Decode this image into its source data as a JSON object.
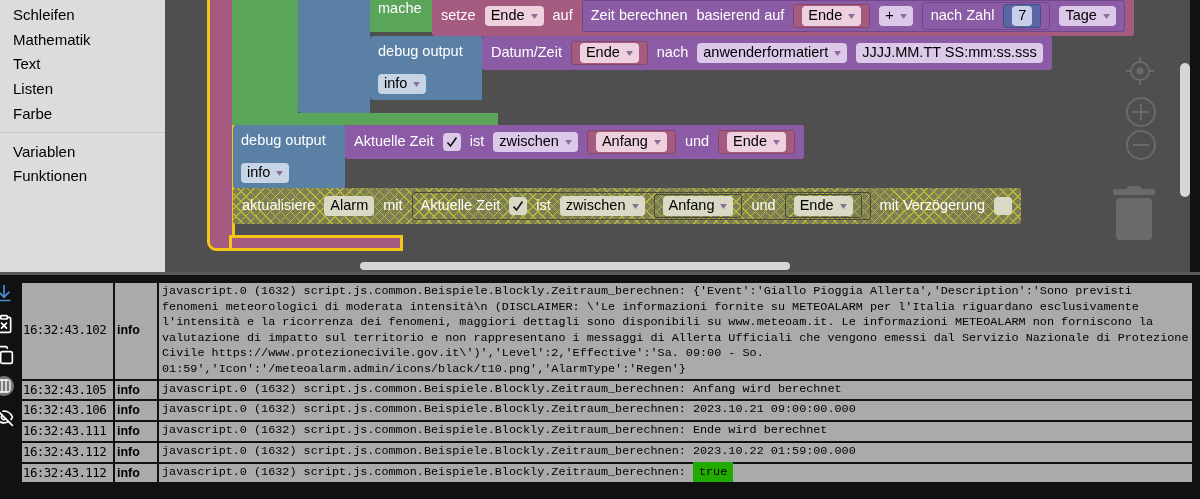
{
  "toolbox": {
    "groups": [
      {
        "items": [
          "Schleifen",
          "Mathematik",
          "Text",
          "Listen",
          "Farbe"
        ]
      },
      {
        "items": [
          "Variablen",
          "Funktionen"
        ]
      }
    ]
  },
  "workspace": {
    "event_block": {
      "selected": true
    },
    "loop_block": {
      "label": "mache"
    },
    "blocks": [
      {
        "kind": "variable",
        "parts": [
          {
            "kind": "label",
            "text": "setze"
          },
          {
            "kind": "dropdown",
            "text": "Ende"
          },
          {
            "kind": "label",
            "text": "auf"
          },
          {
            "kind": "block",
            "block": {
              "kind": "time",
              "parts": [
                {
                  "kind": "label",
                  "text": "Zeit berechnen"
                },
                {
                  "kind": "label",
                  "text": "basierend auf"
                },
                {
                  "kind": "block",
                  "block": {
                    "kind": "variable",
                    "parts": [
                      {
                        "kind": "dropdown",
                        "text": "Ende"
                      }
                    ]
                  }
                },
                {
                  "kind": "dropdown",
                  "text": "+"
                },
                {
                  "kind": "block",
                  "block": {
                    "kind": "time",
                    "parts": [
                      {
                        "kind": "label",
                        "text": "nach Zahl"
                      },
                      {
                        "kind": "block",
                        "block": {
                          "kind": "math",
                          "parts": [
                            {
                              "kind": "field",
                              "text": "7"
                            }
                          ]
                        }
                      }
                    ]
                  }
                },
                {
                  "kind": "dropdown",
                  "text": "Tage"
                }
              ]
            }
          }
        ]
      },
      {
        "kind": "debug",
        "parts": [
          {
            "kind": "label",
            "text": "debug output"
          },
          {
            "kind": "dropdown",
            "text": "info"
          }
        ],
        "input": {
          "kind": "time",
          "parts": [
            {
              "kind": "label",
              "text": "Datum/Zeit"
            },
            {
              "kind": "block",
              "block": {
                "kind": "variable",
                "parts": [
                  {
                    "kind": "dropdown",
                    "text": "Ende"
                  }
                ]
              }
            },
            {
              "kind": "label",
              "text": "nach"
            },
            {
              "kind": "dropdown",
              "text": "anwenderformatiert"
            },
            {
              "kind": "field",
              "text": "JJJJ.MM.TT SS:mm:ss.sss"
            }
          ]
        }
      },
      {
        "kind": "debug",
        "parts": [
          {
            "kind": "label",
            "text": "debug output"
          },
          {
            "kind": "dropdown",
            "text": "info"
          }
        ],
        "input": {
          "kind": "time",
          "parts": [
            {
              "kind": "label",
              "text": "Aktuelle Zeit"
            },
            {
              "kind": "check",
              "checked": true
            },
            {
              "kind": "label",
              "text": "ist"
            },
            {
              "kind": "dropdown",
              "text": "zwischen"
            },
            {
              "kind": "block",
              "block": {
                "kind": "variable",
                "parts": [
                  {
                    "kind": "dropdown",
                    "text": "Anfang"
                  }
                ]
              }
            },
            {
              "kind": "label",
              "text": "und"
            },
            {
              "kind": "block",
              "block": {
                "kind": "variable",
                "parts": [
                  {
                    "kind": "dropdown",
                    "text": "Ende"
                  }
                ]
              }
            }
          ]
        }
      },
      {
        "kind": "alarm",
        "disabled": true,
        "parts": [
          {
            "kind": "label",
            "text": "aktualisiere"
          },
          {
            "kind": "field",
            "text": "Alarm"
          },
          {
            "kind": "label",
            "text": "mit"
          },
          {
            "kind": "block",
            "block": {
              "kind": "time",
              "parts": [
                {
                  "kind": "label",
                  "text": "Aktuelle Zeit"
                },
                {
                  "kind": "check",
                  "checked": true
                },
                {
                  "kind": "label",
                  "text": "ist"
                },
                {
                  "kind": "dropdown",
                  "text": "zwischen"
                },
                {
                  "kind": "block",
                  "block": {
                    "kind": "variable",
                    "parts": [
                      {
                        "kind": "dropdown",
                        "text": "Anfang"
                      }
                    ]
                  }
                },
                {
                  "kind": "label",
                  "text": "und"
                },
                {
                  "kind": "block",
                  "block": {
                    "kind": "variable",
                    "parts": [
                      {
                        "kind": "dropdown",
                        "text": "Ende"
                      }
                    ]
                  }
                }
              ]
            }
          },
          {
            "kind": "label",
            "text": "mit Verzögerung"
          },
          {
            "kind": "check",
            "checked": false
          }
        ]
      }
    ]
  },
  "log": {
    "rows": [
      {
        "time": "16:32:43.102",
        "level": "info",
        "lines": [
          "javascript.0 (1632) script.js.common.Beispiele.Blockly.Zeitraum_berechnen: {'Event':'Giallo Pioggia Allerta','Description':'Sono previsti",
          "fenomeni meteorologici di moderata intensità\\n (DISCLAIMER: \\'Le informazioni fornite su METEOALARM per l'Italia riguardano esclusivamente",
          "l'intensità e la ricorrenza dei fenomeni, maggiori dettagli sono disponibili su www.meteoam.it. Le informazioni METEOALARM non forniscono la",
          "valutazione di impatto sul territorio e non rappresentano i messaggi di Allerta Ufficiali che vengono emessi dal Servizio Nazionale di Protezione",
          "Civile https://www.protezionecivile.gov.it\\')','Level':2,'Effective':'Sa. 09:00 - So.",
          "01:59','Icon':'/meteoalarm.admin/icons/black/t10.png','AlarmType':'Regen'}"
        ]
      },
      {
        "time": "16:32:43.105",
        "level": "info",
        "lines": [
          "javascript.0 (1632) script.js.common.Beispiele.Blockly.Zeitraum_berechnen: Anfang wird berechnet"
        ]
      },
      {
        "time": "16:32:43.106",
        "level": "info",
        "lines": [
          "javascript.0 (1632) script.js.common.Beispiele.Blockly.Zeitraum_berechnen: 2023.10.21 09:00:00.000"
        ]
      },
      {
        "time": "16:32:43.111",
        "level": "info",
        "lines": [
          "javascript.0 (1632) script.js.common.Beispiele.Blockly.Zeitraum_berechnen: Ende wird berechnet"
        ]
      },
      {
        "time": "16:32:43.112",
        "level": "info",
        "lines": [
          "javascript.0 (1632) script.js.common.Beispiele.Blockly.Zeitraum_berechnen: 2023.10.22 01:59:00.000"
        ]
      },
      {
        "time": "16:32:43.112",
        "level": "info",
        "lines": [
          "javascript.0 (1632) script.js.common.Beispiele.Blockly.Zeitraum_berechnen: "
        ],
        "highlight": "true"
      }
    ]
  }
}
